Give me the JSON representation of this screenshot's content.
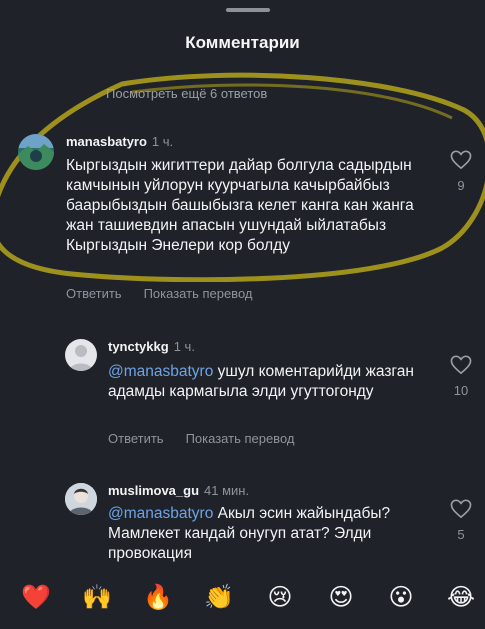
{
  "sheet": {
    "title": "Комментарии",
    "view_replies": "Посмотреть ещё 6 ответов"
  },
  "comments": [
    {
      "username": "manasbatyro",
      "time": "1 ч.",
      "mention": "",
      "text": "Кыргыздын жигиттери дайар болгула садырдын камчынын уйлорун куурчагыла качырбайбыз баарыбыздын башыбызга келет канга кан жанга жан ташиевдин апасын ушундай ыйлатабыз Кыргыздын Энелери кор болду",
      "reply_label": "Ответить",
      "translate_label": "Показать перевод",
      "likes": "9"
    },
    {
      "username": "tynctykkg",
      "time": "1 ч.",
      "mention": "@manasbatyro",
      "text": " ушул коментарийди жазган адамды кармагыла элди угуттогонду",
      "reply_label": "Ответить",
      "translate_label": "Показать перевод",
      "likes": "10"
    },
    {
      "username": "muslimova_gu",
      "time": "41 мин.",
      "mention": "@manasbatyro",
      "text": " Акыл эсин жайындабы? Мамлекет кандай онугуп атат? Элди провокация",
      "likes": "5"
    }
  ],
  "reactions": [
    "❤️",
    "🙌",
    "🔥",
    "👏",
    "😢",
    "😍",
    "😮",
    "😂"
  ],
  "colors": {
    "background": "#1f2329",
    "mention": "#6ea3e6",
    "secondary_text": "#8f939a",
    "highlight_ring": "#c9b51a"
  }
}
